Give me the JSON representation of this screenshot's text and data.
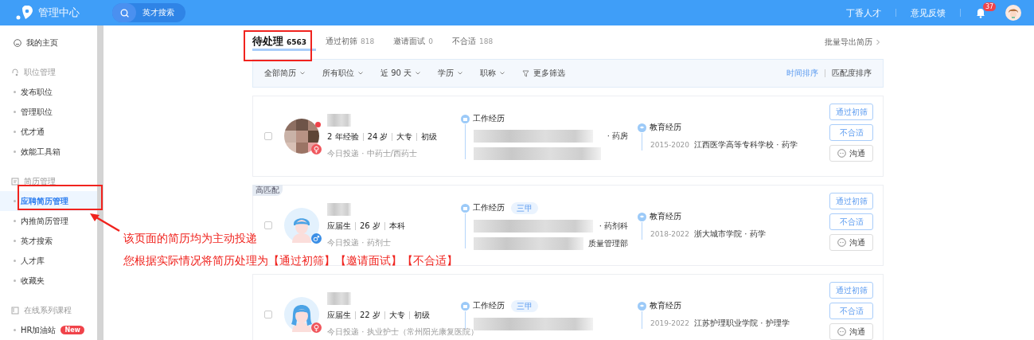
{
  "header": {
    "title": "管理中心",
    "search_label": "英才搜索",
    "links": [
      "丁香人才",
      "意见反馈"
    ],
    "notification_count": "37"
  },
  "sidebar": {
    "items": [
      {
        "kind": "top",
        "label": "我的主页",
        "selected": false
      },
      {
        "kind": "section",
        "label": "职位管理",
        "selected": false
      },
      {
        "kind": "item",
        "label": "发布职位",
        "selected": false
      },
      {
        "kind": "item",
        "label": "管理职位",
        "selected": false
      },
      {
        "kind": "item",
        "label": "优才通",
        "selected": false
      },
      {
        "kind": "item",
        "label": "效能工具箱",
        "selected": false
      },
      {
        "kind": "section",
        "label": "简历管理",
        "selected": false
      },
      {
        "kind": "item",
        "label": "应聘简历管理",
        "selected": true
      },
      {
        "kind": "item",
        "label": "内推简历管理",
        "selected": false
      },
      {
        "kind": "item",
        "label": "英才搜索",
        "selected": false
      },
      {
        "kind": "item",
        "label": "人才库",
        "selected": false
      },
      {
        "kind": "item",
        "label": "收藏夹",
        "selected": false
      },
      {
        "kind": "section",
        "label": "在线系列课程",
        "selected": false
      },
      {
        "kind": "item",
        "label": "HR加油站",
        "badge": "New",
        "selected": false
      }
    ]
  },
  "tabs": [
    {
      "label": "待处理",
      "count": "6563",
      "selected": true
    },
    {
      "label": "通过初筛",
      "count": "818",
      "selected": false
    },
    {
      "label": "邀请面试",
      "count": "0",
      "selected": false
    },
    {
      "label": "不合适",
      "count": "188",
      "selected": false
    }
  ],
  "export_link": "批量导出简历",
  "filters": [
    {
      "kind": "dropdown",
      "label": "全部简历"
    },
    {
      "kind": "dropdown",
      "label": "所有职位"
    },
    {
      "kind": "dropdown",
      "label": "近 90 天"
    },
    {
      "kind": "dropdown",
      "label": "学历"
    },
    {
      "kind": "dropdown",
      "label": "职称"
    },
    {
      "kind": "more",
      "label": "更多筛选"
    }
  ],
  "sort": [
    {
      "label": "时间排序",
      "selected": true
    },
    {
      "label": "匹配度排序",
      "selected": false
    }
  ],
  "candidates": [
    {
      "checked": false,
      "gender_symbol": "♀",
      "unread": true,
      "facts": [
        "2 年经验",
        "24 岁",
        "大专",
        "初级"
      ],
      "applied": "今日投递 · 中药士/西药士",
      "work_title": "工作经历",
      "work_rows": [
        {
          "kind": "detail",
          "detail": "· 药房"
        },
        {
          "kind": "blurred"
        }
      ],
      "education_title": "教育经历",
      "education_years": "2015-2020",
      "education_school": "江西医学高等专科学校 · 药学",
      "actions": [
        {
          "kind": "primary",
          "label": "通过初筛"
        },
        {
          "kind": "primary",
          "label": "不合适"
        },
        {
          "kind": "chat",
          "label": "沟通"
        }
      ]
    },
    {
      "badge": "高匹配",
      "kind": "man",
      "checked": false,
      "gender_symbol": "♂",
      "unread": false,
      "facts": [
        "应届生",
        "26 岁",
        "本科"
      ],
      "applied": "今日投递 · 药剂士",
      "work_title": "工作经历",
      "work_tag": "三甲",
      "work_rows": [
        {
          "kind": "detail",
          "detail": "· 药剂科"
        },
        {
          "kind": "detail",
          "detail": "质量管理部"
        }
      ],
      "education_title": "教育经历",
      "education_years": "2018-2022",
      "education_school": "浙大城市学院 · 药学",
      "actions": [
        {
          "kind": "primary",
          "label": "通过初筛"
        },
        {
          "kind": "primary",
          "label": "不合适"
        },
        {
          "kind": "chat",
          "label": "沟通"
        }
      ]
    },
    {
      "kind": "woman",
      "checked": false,
      "gender_symbol": "♀",
      "unread": false,
      "facts": [
        "应届生",
        "22 岁",
        "大专",
        "初级"
      ],
      "applied": "今日投递 · 执业护士（常州阳光康复医院）",
      "work_title": "工作经历",
      "work_tag": "三甲",
      "work_rows": [
        {
          "kind": "blurred"
        }
      ],
      "education_title": "教育经历",
      "education_years": "2019-2022",
      "education_school": "江苏护理职业学院 · 护理学",
      "actions": [
        {
          "kind": "primary",
          "label": "通过初筛"
        },
        {
          "kind": "primary",
          "label": "不合适"
        },
        {
          "kind": "chat",
          "label": "沟通"
        }
      ]
    }
  ],
  "annotation": {
    "lines": [
      "该页面的简历均为主动投递",
      "您根据实际情况将简历处理为【通过初筛】【邀请面试】【不合适】"
    ]
  }
}
